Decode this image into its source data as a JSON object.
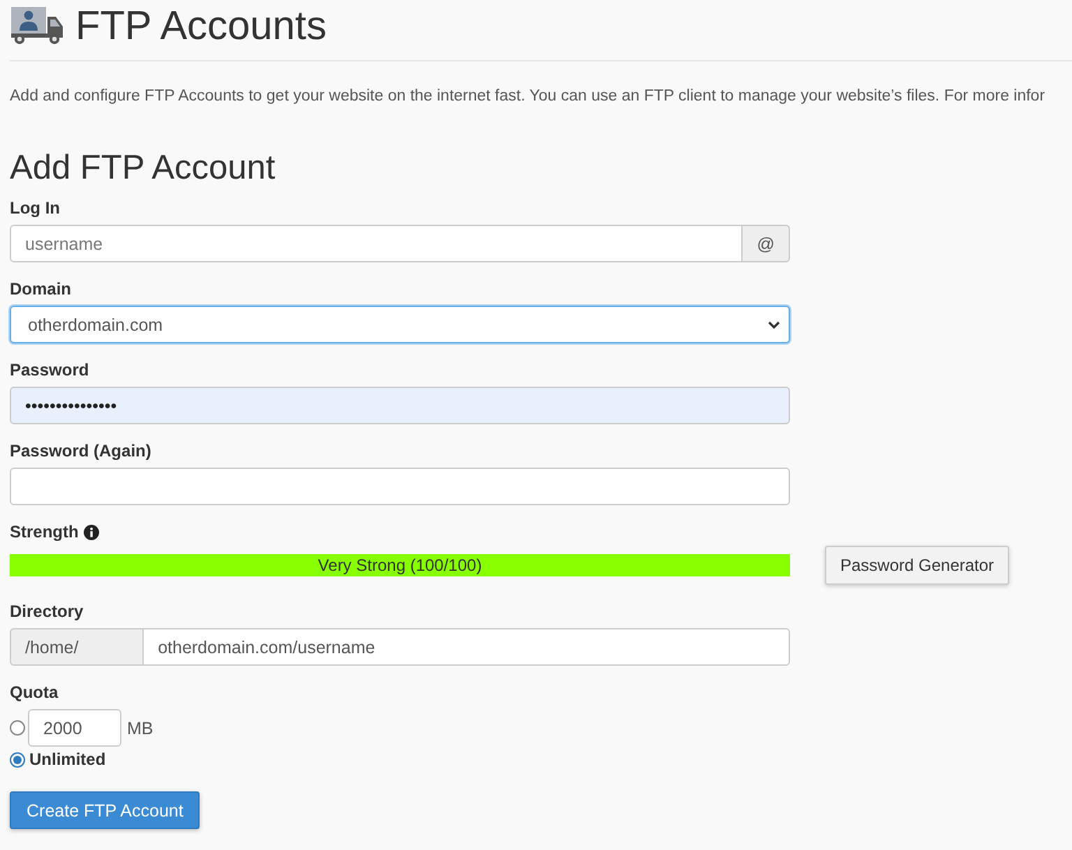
{
  "header": {
    "title": "FTP Accounts",
    "description": "Add and configure FTP Accounts to get your website on the internet fast. You can use an FTP client to manage your website’s files. For more infor"
  },
  "form": {
    "title": "Add FTP Account",
    "login": {
      "label": "Log In",
      "placeholder": "username",
      "addon": "@"
    },
    "domain": {
      "label": "Domain",
      "value": "otherdomain.com",
      "focused": true
    },
    "password": {
      "label": "Password",
      "value": "•••••••••••••••",
      "highlighted": true
    },
    "password_again": {
      "label": "Password (Again)"
    },
    "strength": {
      "label": "Strength",
      "level": 1,
      "reading": "Very Strong (100/100)",
      "button": "Password Generator"
    },
    "directory": {
      "label": "Directory",
      "prefix": "/home/",
      "value": "otherdomain.com/username"
    },
    "quota": {
      "label": "Quota",
      "options": [
        {
          "kind": "limit",
          "value": "2000",
          "unit": "MB",
          "selected": false
        },
        {
          "kind": "unlimited",
          "label": "Unlimited",
          "selected": true
        }
      ]
    },
    "submit": "Create FTP Account"
  }
}
